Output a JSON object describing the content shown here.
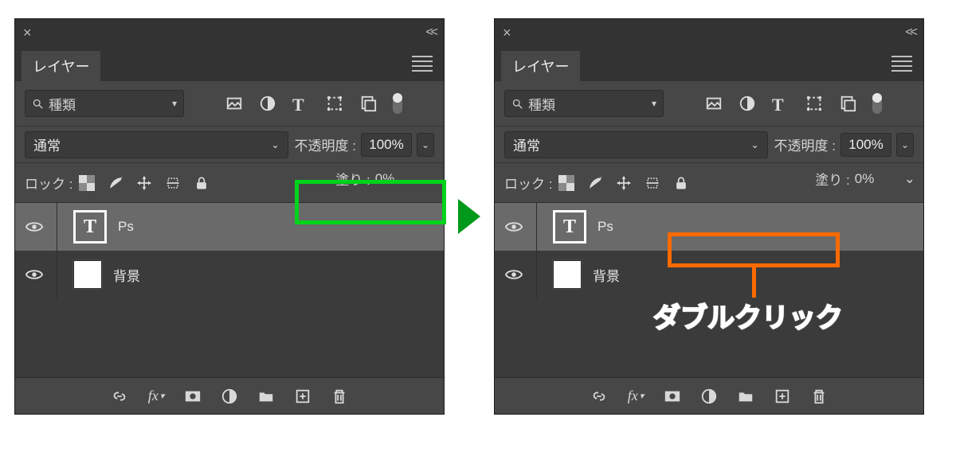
{
  "tab_title": "レイヤー",
  "filter": {
    "kind_label": "種類"
  },
  "blend": {
    "mode": "通常",
    "opacity_label": "不透明度 :",
    "opacity_value": "100%"
  },
  "lock": {
    "label": "ロック :",
    "fill_label": "塗り :",
    "fill_value": "0%"
  },
  "layers": [
    {
      "type": "text",
      "thumb_letter": "T",
      "name": "Ps"
    },
    {
      "type": "pixel",
      "name": "背景"
    }
  ],
  "annotation": {
    "double_click": "ダブルクリック"
  }
}
